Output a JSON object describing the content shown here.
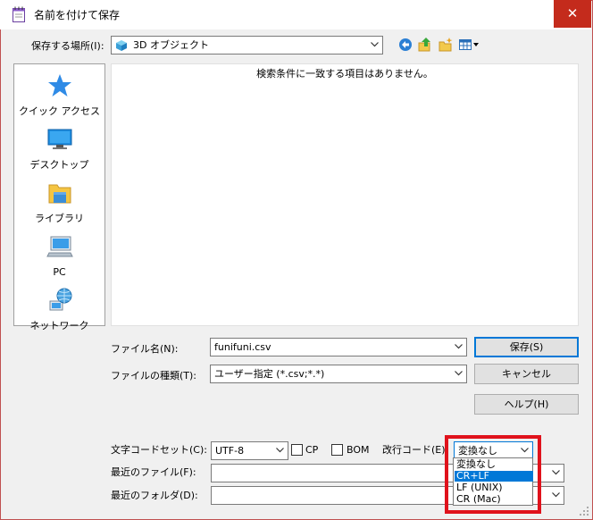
{
  "window": {
    "title": "名前を付けて保存",
    "close_glyph": "✕"
  },
  "lookin": {
    "label": "保存する場所(I):",
    "value": "3D オブジェクト",
    "icon": "3d-objects-icon"
  },
  "toolbar": {
    "icons": [
      "back-icon",
      "up-folder-icon",
      "new-folder-icon",
      "view-menu-icon"
    ]
  },
  "places": [
    {
      "label": "クイック アクセス",
      "icon": "star-icon"
    },
    {
      "label": "デスクトップ",
      "icon": "desktop-icon"
    },
    {
      "label": "ライブラリ",
      "icon": "library-icon"
    },
    {
      "label": "PC",
      "icon": "pc-icon"
    },
    {
      "label": "ネットワーク",
      "icon": "network-icon"
    }
  ],
  "file_list": {
    "empty_message": "検索条件に一致する項目はありません。"
  },
  "filename": {
    "label": "ファイル名(N):",
    "value": "funifuni.csv"
  },
  "filetype": {
    "label": "ファイルの種類(T):",
    "value": "ユーザー指定 (*.csv;*.*)"
  },
  "buttons": {
    "save": "保存(S)",
    "cancel": "キャンセル",
    "help": "ヘルプ(H)"
  },
  "options": {
    "charset_label": "文字コードセット(C):",
    "charset_value": "UTF-8",
    "cp_label": "CP",
    "bom_label": "BOM",
    "eol_label": "改行コード(E):",
    "eol_value": "変換なし",
    "eol_options": [
      "変換なし",
      "CR+LF",
      "LF (UNIX)",
      "CR (Mac)"
    ],
    "eol_selected_index": 1
  },
  "recent": {
    "files_label": "最近のファイル(F):",
    "files_value": "",
    "folders_label": "最近のフォルダ(D):",
    "folders_value": ""
  },
  "colors": {
    "accent": "#0078d7",
    "highlight_box": "#e0121c",
    "close_button": "#c42b1c"
  }
}
